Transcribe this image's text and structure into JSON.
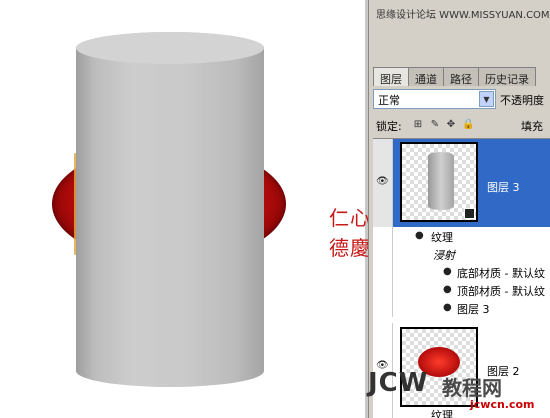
{
  "site_text": "思缘设计论坛 WWW.MISSYUAN.COM",
  "seal": {
    "line1": "仁心",
    "line2": "德慶"
  },
  "panel": {
    "tabs": [
      {
        "label": "图层",
        "active": true
      },
      {
        "label": "通道",
        "active": false
      },
      {
        "label": "路径",
        "active": false
      },
      {
        "label": "历史记录",
        "active": false
      }
    ],
    "blend_mode": "正常",
    "opacity_label": "不透明度",
    "lock_label": "锁定:",
    "fill_label": "填充"
  },
  "layers": {
    "layer3": {
      "name": "图层 3"
    },
    "effects": [
      {
        "label": "纹理"
      },
      {
        "label": "浸射"
      },
      {
        "label": "底部材质 - 默认纹"
      },
      {
        "label": "顶部材质 - 默认纹"
      },
      {
        "label": "图层 3"
      }
    ],
    "layer2": {
      "name": "图层 2",
      "effect": "纹理"
    }
  },
  "watermark": {
    "text": "JCW",
    "cn": "教程网",
    "url": "jcwcn.com"
  },
  "colors": {
    "selected_layer": "#3169c6",
    "panel_bg": "#d4d0c8",
    "seal": "#c81a1a"
  }
}
